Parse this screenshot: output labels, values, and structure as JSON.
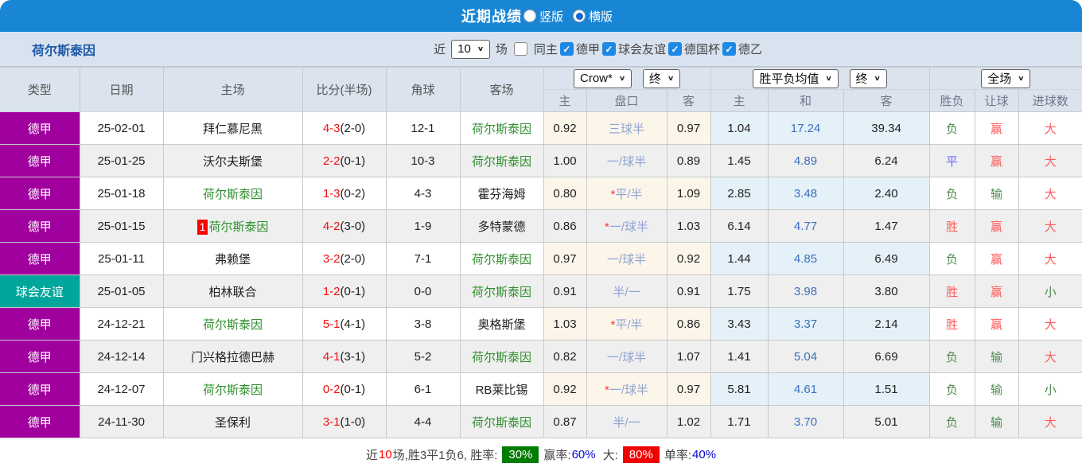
{
  "colors": {
    "titlebar_bg": "#1986d5",
    "filterbar_bg": "#d9e3f0",
    "header_bg": "#dae3ee",
    "league_purple": "#a0009e",
    "league_teal": "#00a69c",
    "checkbox_blue": "#1e88e5",
    "team_highlight_green": "#2f8f2f",
    "score_red": "#f10f0f",
    "handicap_blue": "#8fa3d2",
    "avg_draw_blue": "#3d6fbe",
    "win_red": "#ff5a5a",
    "lose_green": "#4e8a4e",
    "draw_blue": "#6b6bff",
    "rate_green_bg": "#007d00",
    "rate_red_bg": "#f00000",
    "rate_blue_text": "#0a0ad6",
    "stripe_gray": "#efefef",
    "odds_cream_bg": "#fbf5ea",
    "avg_blue_bg": "#e5f1f8"
  },
  "icons": {
    "chevron_down": "∨",
    "check": "✓"
  },
  "titlebar": {
    "title": "近期战绩",
    "vertical_label": "竖版",
    "horizontal_label": "横版"
  },
  "filter": {
    "team": "荷尔斯泰因",
    "recent_label": "近",
    "recent_count": "10",
    "matches_label": "场",
    "same_home_label": "同主",
    "leagues": [
      {
        "label": "德甲"
      },
      {
        "label": "球会友谊"
      },
      {
        "label": "德国杯"
      },
      {
        "label": "德乙"
      }
    ]
  },
  "table": {
    "selects": {
      "bookmaker": "Crow*",
      "bookmaker_time": "终",
      "avg": "胜平负均值",
      "avg_time": "终",
      "scope": "全场"
    },
    "headers": {
      "type": "类型",
      "date": "日期",
      "home": "主场",
      "score": "比分(半场)",
      "corner": "角球",
      "away": "客场",
      "sub": [
        "主",
        "盘口",
        "客",
        "主",
        "和",
        "客",
        "胜负",
        "让球",
        "进球数"
      ]
    },
    "rows": [
      {
        "league": "德甲",
        "league_class": "purple",
        "date": "25-02-01",
        "badge": "",
        "home": "拜仁慕尼黑",
        "home_class": "",
        "score": "4-3",
        "half": "(2-0)",
        "corner": "12-1",
        "away": "荷尔斯泰因",
        "away_class": "green-team",
        "crow_home": "0.92",
        "star": "",
        "handicap": "三球半",
        "crow_away": "0.97",
        "avg_home": "1.04",
        "avg_draw": "17.24",
        "avg_away": "39.34",
        "wdl": "负",
        "wdl_class": "green",
        "let": "赢",
        "let_class": "red",
        "goal": "大",
        "goal_class": "red"
      },
      {
        "league": "德甲",
        "league_class": "purple",
        "date": "25-01-25",
        "badge": "",
        "home": "沃尔夫斯堡",
        "home_class": "",
        "score": "2-2",
        "half": "(0-1)",
        "corner": "10-3",
        "away": "荷尔斯泰因",
        "away_class": "green-team",
        "crow_home": "1.00",
        "star": "",
        "handicap": "一/球半",
        "crow_away": "0.89",
        "avg_home": "1.45",
        "avg_draw": "4.89",
        "avg_away": "6.24",
        "wdl": "平",
        "wdl_class": "blue",
        "let": "赢",
        "let_class": "red",
        "goal": "大",
        "goal_class": "red"
      },
      {
        "league": "德甲",
        "league_class": "purple",
        "date": "25-01-18",
        "badge": "",
        "home": "荷尔斯泰因",
        "home_class": "green-team",
        "score": "1-3",
        "half": "(0-2)",
        "corner": "4-3",
        "away": "霍芬海姆",
        "away_class": "",
        "crow_home": "0.80",
        "star": "*",
        "handicap": "平/半",
        "crow_away": "1.09",
        "avg_home": "2.85",
        "avg_draw": "3.48",
        "avg_away": "2.40",
        "wdl": "负",
        "wdl_class": "green",
        "let": "输",
        "let_class": "green",
        "goal": "大",
        "goal_class": "red"
      },
      {
        "league": "德甲",
        "league_class": "purple",
        "date": "25-01-15",
        "badge": "1",
        "home": "荷尔斯泰因",
        "home_class": "green-team",
        "score": "4-2",
        "half": "(3-0)",
        "corner": "1-9",
        "away": "多特蒙德",
        "away_class": "",
        "crow_home": "0.86",
        "star": "*",
        "handicap": "一/球半",
        "crow_away": "1.03",
        "avg_home": "6.14",
        "avg_draw": "4.77",
        "avg_away": "1.47",
        "wdl": "胜",
        "wdl_class": "red",
        "let": "赢",
        "let_class": "red",
        "goal": "大",
        "goal_class": "red"
      },
      {
        "league": "德甲",
        "league_class": "purple",
        "date": "25-01-11",
        "badge": "",
        "home": "弗赖堡",
        "home_class": "",
        "score": "3-2",
        "half": "(2-0)",
        "corner": "7-1",
        "away": "荷尔斯泰因",
        "away_class": "green-team",
        "crow_home": "0.97",
        "star": "",
        "handicap": "一/球半",
        "crow_away": "0.92",
        "avg_home": "1.44",
        "avg_draw": "4.85",
        "avg_away": "6.49",
        "wdl": "负",
        "wdl_class": "green",
        "let": "赢",
        "let_class": "red",
        "goal": "大",
        "goal_class": "red"
      },
      {
        "league": "球会友谊",
        "league_class": "teal",
        "date": "25-01-05",
        "badge": "",
        "home": "柏林联合",
        "home_class": "",
        "score": "1-2",
        "half": "(0-1)",
        "corner": "0-0",
        "away": "荷尔斯泰因",
        "away_class": "green-team",
        "crow_home": "0.91",
        "star": "",
        "handicap": "半/一",
        "crow_away": "0.91",
        "avg_home": "1.75",
        "avg_draw": "3.98",
        "avg_away": "3.80",
        "wdl": "胜",
        "wdl_class": "red",
        "let": "赢",
        "let_class": "red",
        "goal": "小",
        "goal_class": "green"
      },
      {
        "league": "德甲",
        "league_class": "purple",
        "date": "24-12-21",
        "badge": "",
        "home": "荷尔斯泰因",
        "home_class": "green-team",
        "score": "5-1",
        "half": "(4-1)",
        "corner": "3-8",
        "away": "奥格斯堡",
        "away_class": "",
        "crow_home": "1.03",
        "star": "*",
        "handicap": "平/半",
        "crow_away": "0.86",
        "avg_home": "3.43",
        "avg_draw": "3.37",
        "avg_away": "2.14",
        "wdl": "胜",
        "wdl_class": "red",
        "let": "赢",
        "let_class": "red",
        "goal": "大",
        "goal_class": "red"
      },
      {
        "league": "德甲",
        "league_class": "purple",
        "date": "24-12-14",
        "badge": "",
        "home": "门兴格拉德巴赫",
        "home_class": "",
        "score": "4-1",
        "half": "(3-1)",
        "corner": "5-2",
        "away": "荷尔斯泰因",
        "away_class": "green-team",
        "crow_home": "0.82",
        "star": "",
        "handicap": "一/球半",
        "crow_away": "1.07",
        "avg_home": "1.41",
        "avg_draw": "5.04",
        "avg_away": "6.69",
        "wdl": "负",
        "wdl_class": "green",
        "let": "输",
        "let_class": "green",
        "goal": "大",
        "goal_class": "red"
      },
      {
        "league": "德甲",
        "league_class": "purple",
        "date": "24-12-07",
        "badge": "",
        "home": "荷尔斯泰因",
        "home_class": "green-team",
        "score": "0-2",
        "half": "(0-1)",
        "corner": "6-1",
        "away": "RB莱比锡",
        "away_class": "",
        "crow_home": "0.92",
        "star": "*",
        "handicap": "一/球半",
        "crow_away": "0.97",
        "avg_home": "5.81",
        "avg_draw": "4.61",
        "avg_away": "1.51",
        "wdl": "负",
        "wdl_class": "green",
        "let": "输",
        "let_class": "green",
        "goal": "小",
        "goal_class": "green"
      },
      {
        "league": "德甲",
        "league_class": "purple",
        "date": "24-11-30",
        "badge": "",
        "home": "圣保利",
        "home_class": "",
        "score": "3-1",
        "half": "(1-0)",
        "corner": "4-4",
        "away": "荷尔斯泰因",
        "away_class": "green-team",
        "crow_home": "0.87",
        "star": "",
        "handicap": "半/一",
        "crow_away": "1.02",
        "avg_home": "1.71",
        "avg_draw": "3.70",
        "avg_away": "5.01",
        "wdl": "负",
        "wdl_class": "green",
        "let": "输",
        "let_class": "green",
        "goal": "大",
        "goal_class": "red"
      }
    ]
  },
  "footer": {
    "prefix": "近",
    "count": "10",
    "summary": "场,胜3平1负6, 胜率:",
    "win_rate": "30%",
    "handicap_label": "赢率:",
    "handicap_rate": "60%",
    "big_label": "大:",
    "big_rate": "80%",
    "single_label": "单率:",
    "single_rate": "40%"
  }
}
